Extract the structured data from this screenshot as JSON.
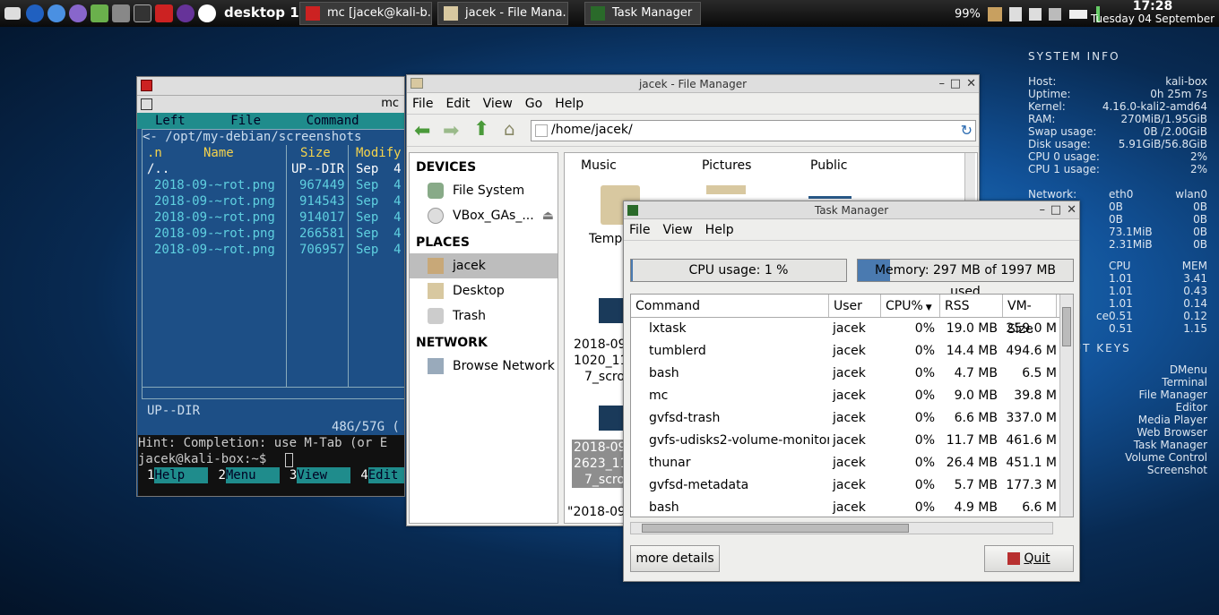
{
  "taskbar": {
    "desktop_label": "desktop 1",
    "tasks": [
      {
        "label": "mc [jacek@kali-b..."
      },
      {
        "label": "jacek - File Mana..."
      },
      {
        "label": "Task Manager"
      }
    ],
    "battery": "99%",
    "time": "17:28",
    "date": "Tuesday 04 September"
  },
  "conky": {
    "system_header": "SYSTEM INFO",
    "info": [
      {
        "k": "Host:",
        "v": "kali-box"
      },
      {
        "k": "Uptime:",
        "v": "0h 25m 7s"
      },
      {
        "k": "Kernel:",
        "v": "4.16.0-kali2-amd64"
      },
      {
        "k": "RAM:",
        "v": "270MiB/1.95GiB"
      },
      {
        "k": "Swap usage:",
        "v": "0B  /2.00GiB"
      },
      {
        "k": "Disk usage:",
        "v": "5.91GiB/56.8GiB"
      },
      {
        "k": "CPU 0 usage:",
        "v": "2%"
      },
      {
        "k": "CPU 1 usage:",
        "v": "2%"
      }
    ],
    "net_header": {
      "k": "Network:",
      "a": "eth0",
      "b": "wlan0"
    },
    "net_rows": [
      {
        "k": "",
        "a": "0B",
        "b": "0B"
      },
      {
        "k": "",
        "a": "0B",
        "b": "0B"
      },
      {
        "k": ":",
        "a": "73.1MiB",
        "b": "0B"
      },
      {
        "k": "",
        "a": "2.31MiB",
        "b": "0B"
      }
    ],
    "proc_header": {
      "a": "CPU",
      "b": "MEM"
    },
    "proc_rows": [
      {
        "k": "",
        "a": "1.01",
        "b": "3.41"
      },
      {
        "k": "",
        "a": "1.01",
        "b": "0.43"
      },
      {
        "k": "",
        "a": "1.01",
        "b": "0.14"
      },
      {
        "k": "ce",
        "a": "0.51",
        "b": "0.12"
      },
      {
        "k": "",
        "a": "0.51",
        "b": "1.15"
      }
    ],
    "keys_header": "CUT KEYS",
    "keys": [
      "DMenu",
      "Terminal",
      "File Manager",
      "Editor",
      "Media Player",
      "Web Browser",
      "Task Manager",
      "Volume Control",
      "Screenshot"
    ]
  },
  "mc": {
    "title": "mc",
    "menu": "Left      File      Command      O",
    "path": "<- /opt/my-debian/screenshots",
    "col_n": ".n",
    "col_name": "Name",
    "col_size": "Size",
    "col_modify": "Modify",
    "parent": {
      "name": "/..",
      "size": "UP--DIR",
      "date": "Sep  4"
    },
    "files": [
      {
        "name": "2018-09-~rot.png",
        "size": "967449",
        "date": "Sep  4"
      },
      {
        "name": "2018-09-~rot.png",
        "size": "914543",
        "date": "Sep  4"
      },
      {
        "name": "2018-09-~rot.png",
        "size": "914017",
        "date": "Sep  4"
      },
      {
        "name": "2018-09-~rot.png",
        "size": "266581",
        "date": "Sep  4"
      },
      {
        "name": "2018-09-~rot.png",
        "size": "706957",
        "date": "Sep  4"
      }
    ],
    "status": "UP--DIR",
    "disk": "48G/57G (",
    "hint": "Hint: Completion: use M-Tab (or E",
    "prompt": "jacek@kali-box:~$",
    "fkeys": [
      {
        "n": "1",
        "l": "Help"
      },
      {
        "n": "2",
        "l": "Menu"
      },
      {
        "n": "3",
        "l": "View"
      },
      {
        "n": "4",
        "l": "Edit"
      }
    ]
  },
  "fm": {
    "title": "jacek - File Manager",
    "menu": [
      "File",
      "Edit",
      "View",
      "Go",
      "Help"
    ],
    "location": "/home/jacek/",
    "devices_header": "DEVICES",
    "devices": [
      "File System",
      "VBox_GAs_..."
    ],
    "places_header": "PLACES",
    "places": [
      "jacek",
      "Desktop",
      "Trash"
    ],
    "network_header": "NETWORK",
    "network": [
      "Browse Network"
    ],
    "folders": [
      "Music",
      "Pictures",
      "Public"
    ],
    "items": [
      "Temp",
      "2018-09",
      "1020_11",
      "7_scro",
      "2018-09",
      "2623_11",
      "7_scro"
    ],
    "status": "\"2018-09"
  },
  "tm": {
    "title": "Task Manager",
    "menu": [
      "File",
      "View",
      "Help"
    ],
    "cpu_label": "CPU usage: 1 %",
    "cpu_fraction": 0.01,
    "mem_label": "Memory: 297 MB of 1997 MB used",
    "mem_fraction": 0.149,
    "headers": [
      "Command",
      "User",
      "CPU%",
      "RSS",
      "VM-Size"
    ],
    "rows": [
      {
        "cmd": "lxtask",
        "user": "jacek",
        "cpu": "0%",
        "rss": "19.0 MB",
        "vm": "259.0 M"
      },
      {
        "cmd": "tumblerd",
        "user": "jacek",
        "cpu": "0%",
        "rss": "14.4 MB",
        "vm": "494.6 M"
      },
      {
        "cmd": "bash",
        "user": "jacek",
        "cpu": "0%",
        "rss": "4.7 MB",
        "vm": "6.5 M"
      },
      {
        "cmd": "mc",
        "user": "jacek",
        "cpu": "0%",
        "rss": "9.0 MB",
        "vm": "39.8 M"
      },
      {
        "cmd": "gvfsd-trash",
        "user": "jacek",
        "cpu": "0%",
        "rss": "6.6 MB",
        "vm": "337.0 M"
      },
      {
        "cmd": "gvfs-udisks2-volume-monitor",
        "user": "jacek",
        "cpu": "0%",
        "rss": "11.7 MB",
        "vm": "461.6 M"
      },
      {
        "cmd": "thunar",
        "user": "jacek",
        "cpu": "0%",
        "rss": "26.4 MB",
        "vm": "451.1 M"
      },
      {
        "cmd": "gvfsd-metadata",
        "user": "jacek",
        "cpu": "0%",
        "rss": "5.7 MB",
        "vm": "177.3 M"
      },
      {
        "cmd": "bash",
        "user": "jacek",
        "cpu": "0%",
        "rss": "4.9 MB",
        "vm": "6.6 M"
      }
    ],
    "more_details": "more details",
    "quit": "Quit"
  }
}
